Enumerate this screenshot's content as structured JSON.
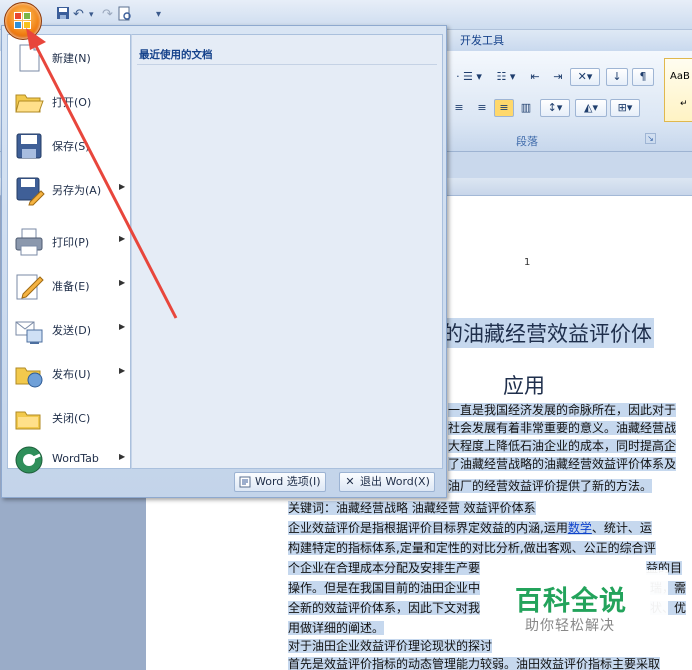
{
  "ribbon": {
    "tab_dev_label": "开发工具",
    "paragraph_group_label": "段落",
    "style_sample": "AaB",
    "style_mark": "↵"
  },
  "office_menu": {
    "recent_title": "最近使用的文档",
    "items": [
      {
        "label": "新建(N)",
        "has_submenu": false
      },
      {
        "label": "打开(O)",
        "has_submenu": false
      },
      {
        "label": "保存(S)",
        "has_submenu": false
      },
      {
        "label": "另存为(A)",
        "has_submenu": true
      },
      {
        "label": "打印(P)",
        "has_submenu": true
      },
      {
        "label": "准备(E)",
        "has_submenu": true
      },
      {
        "label": "发送(D)",
        "has_submenu": true
      },
      {
        "label": "发布(U)",
        "has_submenu": true
      },
      {
        "label": "关闭(C)",
        "has_submenu": false
      },
      {
        "label": "WordTab",
        "has_submenu": true
      }
    ],
    "word_options_label": "Word 选项(I)",
    "exit_word_label": "退出 Word(X)"
  },
  "document": {
    "page_number": "1",
    "title_line_1": "的油藏经营效益评价体",
    "title_line_2": "应用",
    "paragraphs": [
      "一直是我国经济发展的命脉所在，因此对于",
      "社会发展有着非常重要的意义。油藏经营战",
      "大程度上降低石油企业的成本，同时提高企",
      "了油藏经营战略的油藏经营效益评价体系及",
      "油厂的经营效益评价提供了新的方法。",
      "关键词：油藏经营战略 油藏经营 效益评价体系",
      "企业效益评价是指根据评价目标界定效益的内涵,运用",
      "数学",
      "、统计、运",
      "构建特定的指标体系,定量和定性的对比分析,做出客观、公正的综合评",
      "个企业在合理成本分配及安排生产要",
      "益的目",
      "操作。但是在我国目前的油田企业中",
      "瑞，需",
      "全新的效益评价体系，因此下文对我",
      "状、优",
      "用做详细的阐述。",
      "对于油田企业效益评价理论现状的探讨",
      "首先是效益评价指标的动态管理能力较弱。油田效益评价指标主要采取"
    ]
  },
  "watermark": {
    "title": "百科全说",
    "subtitle": "助你轻松解决"
  },
  "colors": {
    "menu_bg": "#d9e5f4",
    "office_button": "#f07d12",
    "annotation_arrow": "#e8463c",
    "selection_highlight": "#c6d8ee",
    "watermark_green": "#23a35b"
  }
}
